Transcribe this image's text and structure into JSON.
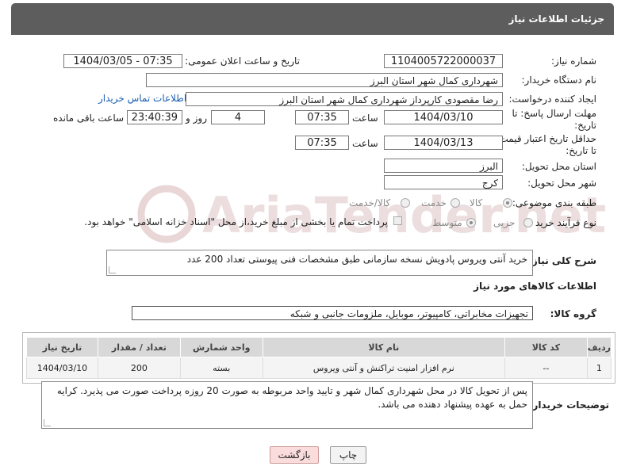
{
  "header": {
    "title": "جزئیات اطلاعات نیاز"
  },
  "form": {
    "need_number_label": "شماره نیاز:",
    "need_number": "1104005722000037",
    "announce_label": "تاریخ و ساعت اعلان عمومی:",
    "announce_value": "1404/03/05 - 07:35",
    "buyer_org_label": "نام دستگاه خریدار:",
    "buyer_org": "شهرداری کمال شهر استان البرز",
    "creator_label": "ایجاد کننده درخواست:",
    "creator": "رضا مقصودی کارپرداز شهرداری کمال شهر استان البرز",
    "contact_link": "اطلاعات تماس خریدار",
    "deadline_label_1": "مهلت ارسال پاسخ: تا",
    "deadline_label_2": "تاریخ:",
    "deadline_date": "1404/03/10",
    "time_label": "ساعت",
    "deadline_time": "07:35",
    "days_value": "4",
    "days_label": "روز و",
    "remaining_time": "23:40:39",
    "remaining_label": "ساعت باقی مانده",
    "validity_label_1": "حداقل تاریخ اعتبار قیمت:",
    "validity_label_2": "تا تاریخ:",
    "validity_date": "1404/03/13",
    "validity_time": "07:35",
    "province_label": "استان محل تحویل:",
    "province": "البرز",
    "city_label": "شهر محل تحویل:",
    "city": "کرج",
    "category_label": "طبقه بندی موضوعی:",
    "category_options": [
      "کالا",
      "خدمت",
      "کالا/خدمت"
    ],
    "process_label": "نوع فرآیند خرید :",
    "process_options": [
      "جزیی",
      "متوسط"
    ],
    "payment_note": "پرداخت تمام یا بخشی از مبلغ خرید،از محل \"اسناد خزانه اسلامی\" خواهد بود."
  },
  "description": {
    "label": "شرح کلی نیاز:",
    "text": "خرید آنتی ویروس پادویش نسخه سازمانی طبق مشخصات فنی پیوستی تعداد 200 عدد"
  },
  "goods": {
    "section_title": "اطلاعات کالاهای مورد نیاز",
    "group_label": "گروه کالا:",
    "group_value": "تجهیزات مخابراتی، کامپیوتر، موبایل، ملزومات جانبی و شبکه",
    "columns": [
      "ردیف",
      "کد کالا",
      "نام کالا",
      "واحد شمارش",
      "تعداد / مقدار",
      "تاریخ نیاز"
    ],
    "rows": [
      {
        "row": "1",
        "code": "--",
        "name": "نرم افزار امنیت تراکنش و آنتی ویروس",
        "unit": "بسته",
        "qty": "200",
        "date": "1404/03/10"
      }
    ]
  },
  "buyer_notes": {
    "label": "توضیحات خریدار:",
    "text": "پس از تحویل کالا در محل شهرداری کمال شهر و تایید واحد مربوطه به صورت 20 روزه پرداخت صورت می پذیرد. کرایه حمل به عهده پیشنهاد دهنده می باشد."
  },
  "buttons": {
    "print": "چاپ",
    "back": "بازگشت"
  },
  "watermark": {
    "text": "AriaTender.net"
  }
}
